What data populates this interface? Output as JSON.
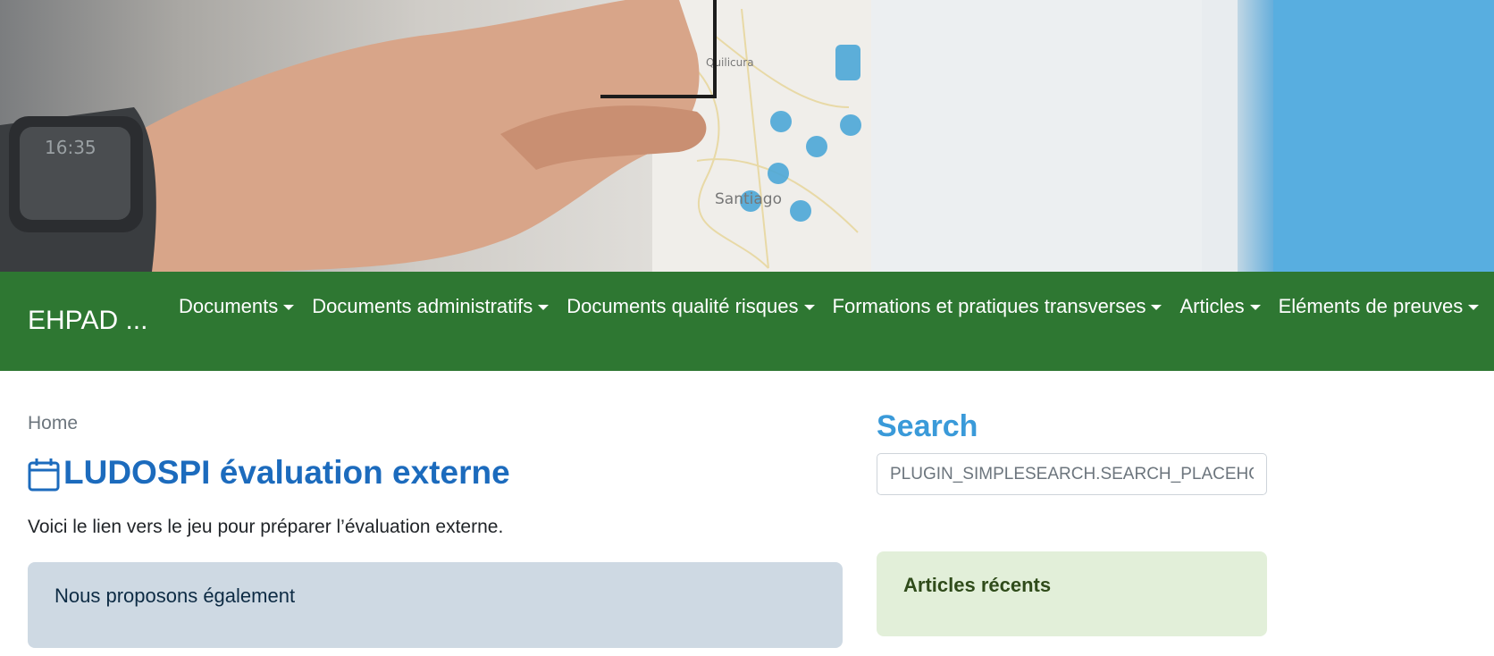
{
  "navbar": {
    "brand": "EHPAD ...",
    "items": [
      {
        "label": "Documents"
      },
      {
        "label": "Documents administratifs"
      },
      {
        "label": "Documents qualité risques"
      },
      {
        "label": "Formations et pratiques transverses"
      },
      {
        "label": "Articles"
      },
      {
        "label": "Eléments de preuves"
      }
    ],
    "background_color": "#2e7732"
  },
  "hero": {
    "watch_time": "16:35"
  },
  "breadcrumb": {
    "home": "Home"
  },
  "article": {
    "icon": "calendar-icon",
    "title": "LUDOSPI évaluation externe",
    "intro": "Voici le lien vers le jeu pour préparer l’évaluation externe.",
    "info_box_text": "Nous proposons également"
  },
  "sidebar": {
    "search_title": "Search",
    "search_placeholder": "PLUGIN_SIMPLESEARCH.SEARCH_PLACEHOLDER",
    "recent_title": "Articles récents"
  },
  "colors": {
    "title_blue": "#1c6bbd",
    "search_title_blue": "#3a9ad9",
    "info_box": "#ced9e3",
    "recent_box": "#e2efd9"
  }
}
